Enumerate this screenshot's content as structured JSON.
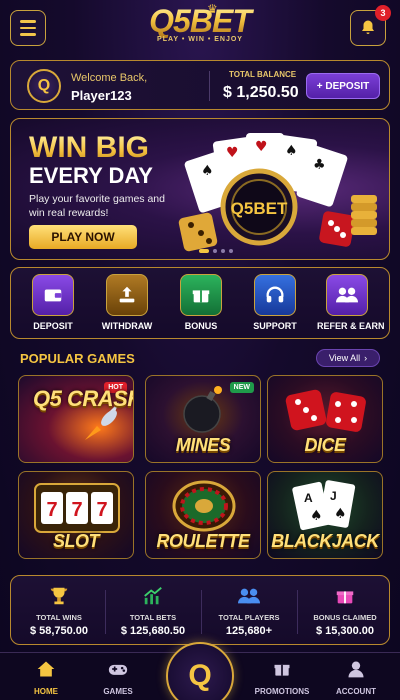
{
  "header": {
    "menu_icon": "hamburger-icon",
    "logo_text": "Q5BET",
    "logo_tagline": "PLAY • WIN • ENJOY",
    "notification_count": "3"
  },
  "welcome": {
    "greeting": "Welcome Back,",
    "username": "Player123",
    "balance_label": "TOTAL BALANCE",
    "balance_value": "$ 1,250.50",
    "deposit_label": "+ DEPOSIT"
  },
  "banner": {
    "title_line1": "WIN BIG",
    "title_line2": "EVERY DAY",
    "subtitle": "Play your favorite games and win real rewards!",
    "cta_label": "PLAY NOW",
    "chip_text": "Q5BET",
    "slide_count": 5,
    "active_slide": 1
  },
  "actions": [
    {
      "label": "DEPOSIT",
      "icon": "wallet-icon",
      "color": "#7b3fd6"
    },
    {
      "label": "WITHDRAW",
      "icon": "withdraw-icon",
      "color": "#a06a1a"
    },
    {
      "label": "BONUS",
      "icon": "gift-icon",
      "color": "#1f9a4a"
    },
    {
      "label": "SUPPORT",
      "icon": "headset-icon",
      "color": "#2458c7"
    },
    {
      "label": "REFER & EARN",
      "icon": "users-icon",
      "color": "#7b3fd6"
    }
  ],
  "popular": {
    "title": "POPULAR GAMES",
    "view_all": "View All",
    "games": [
      {
        "name": "Q5 CRASH",
        "tag": "HOT",
        "tag_color": "#e0202a"
      },
      {
        "name": "MINES",
        "tag": "NEW",
        "tag_color": "#1f9a4a"
      },
      {
        "name": "DICE",
        "tag": "",
        "tag_color": ""
      },
      {
        "name": "SLOT",
        "tag": "",
        "tag_color": ""
      },
      {
        "name": "ROULETTE",
        "tag": "",
        "tag_color": ""
      },
      {
        "name": "BLACKJACK",
        "tag": "",
        "tag_color": ""
      }
    ]
  },
  "stats": [
    {
      "label": "TOTAL WINS",
      "value": "$ 58,750.00",
      "icon": "trophy-icon"
    },
    {
      "label": "TOTAL BETS",
      "value": "$ 125,680.50",
      "icon": "chart-up-icon"
    },
    {
      "label": "TOTAL PLAYERS",
      "value": "125,680+",
      "icon": "users-icon"
    },
    {
      "label": "BONUS CLAIMED",
      "value": "$ 15,300.00",
      "icon": "gift-icon"
    }
  ],
  "nav": [
    {
      "label": "HOME",
      "icon": "home-icon"
    },
    {
      "label": "GAMES",
      "icon": "gamepad-icon"
    },
    {
      "label": "",
      "icon": "q5-logo-icon"
    },
    {
      "label": "PROMOTIONS",
      "icon": "gift-icon"
    },
    {
      "label": "ACCOUNT",
      "icon": "user-icon"
    }
  ]
}
